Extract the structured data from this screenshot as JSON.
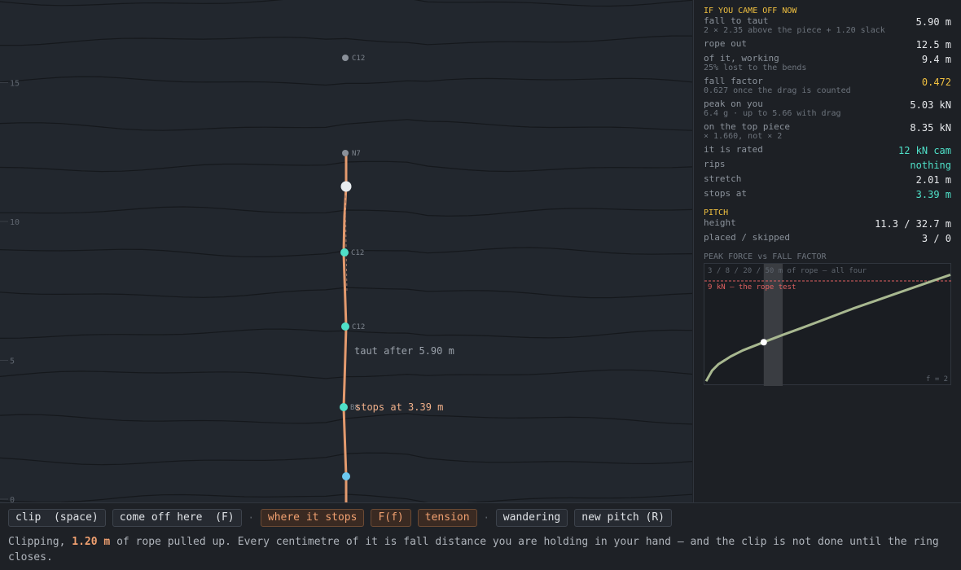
{
  "wall": {
    "axis_ticks": [
      "15",
      "10",
      "5",
      "0"
    ],
    "pieces": [
      {
        "label": "C12",
        "kind": "placed-grey"
      },
      {
        "label": "N7",
        "kind": "top"
      },
      {
        "label": "C12",
        "kind": "clipped"
      },
      {
        "label": "C12",
        "kind": "clipped"
      },
      {
        "label": "B8",
        "kind": "clipped"
      }
    ],
    "annotations": {
      "taut": "taut after 5.90 m",
      "stops": "stops at 3.39 m"
    }
  },
  "panel": {
    "section1_title": "IF YOU CAME OFF NOW",
    "stats": [
      {
        "label": "fall to taut",
        "sub": "2 × 2.35 above the piece + 1.20 slack",
        "value": "5.90 m",
        "color": "white"
      },
      {
        "label": "rope out",
        "sub": "",
        "value": "12.5 m",
        "color": "white"
      },
      {
        "label": "of it, working",
        "sub": "25% lost to the bends",
        "value": "9.4 m",
        "color": "white"
      },
      {
        "label": "fall factor",
        "sub": "0.627 once the drag is counted",
        "value": "0.472",
        "color": "yellow"
      },
      {
        "label": "peak on you",
        "sub": "6.4 g · up to 5.66 with drag",
        "value": "5.03 kN",
        "color": "white"
      },
      {
        "label": "on the top piece",
        "sub": "× 1.660, not × 2",
        "value": "8.35 kN",
        "color": "white"
      },
      {
        "label": "it is rated",
        "sub": "",
        "value": "12 kN cam",
        "color": "cyan"
      },
      {
        "label": "rips",
        "sub": "",
        "value": "nothing",
        "color": "cyan"
      },
      {
        "label": "stretch",
        "sub": "",
        "value": "2.01 m",
        "color": "white"
      },
      {
        "label": "stops at",
        "sub": "",
        "value": "3.39 m",
        "color": "cyan"
      }
    ],
    "section2_title": "PITCH",
    "pitch_stats": [
      {
        "label": "height",
        "value": "11.3 / 32.7 m"
      },
      {
        "label": "placed / skipped",
        "value": "3 / 0"
      }
    ],
    "chart_title": "PEAK FORCE vs FALL FACTOR"
  },
  "chart_data": {
    "type": "line",
    "title": "PEAK FORCE vs FALL FACTOR",
    "top_note": "3 / 8 / 20 / 50 m of rope — all four",
    "threshold_label": "9 kN — the rope test",
    "threshold_kN": 9,
    "xlabel_right": "f = 2",
    "xlim": [
      0,
      2
    ],
    "ylim": [
      2.3,
      10
    ],
    "current_marker": {
      "x": 0.472,
      "y": 5.03
    },
    "highlight_band_x": [
      0.472,
      0.627
    ],
    "series": [
      {
        "x": [
          0.0,
          0.05,
          0.1,
          0.2,
          0.3,
          0.472,
          0.627,
          0.8,
          1.0,
          1.2,
          1.4,
          1.6,
          1.8,
          2.0
        ],
        "y": [
          2.5,
          3.2,
          3.6,
          4.1,
          4.5,
          5.03,
          5.5,
          6.0,
          6.6,
          7.2,
          7.75,
          8.3,
          8.85,
          9.4
        ]
      }
    ],
    "colors": {
      "curve": "#a8b890",
      "threshold": "#e06060",
      "band": "#3a3d42",
      "marker": "#ffffff"
    }
  },
  "buttons": [
    {
      "label": "clip  (space)",
      "style": "normal",
      "name": "clip-button"
    },
    {
      "label": "come off here  (F)",
      "style": "normal",
      "name": "come-off-button"
    },
    {
      "sep": "·"
    },
    {
      "label": "where it stops",
      "style": "orange",
      "name": "where-it-stops-toggle"
    },
    {
      "label": "F(f)",
      "style": "orange",
      "name": "force-function-toggle"
    },
    {
      "label": "tension",
      "style": "orange",
      "name": "tension-toggle"
    },
    {
      "sep": "·"
    },
    {
      "label": "wandering",
      "style": "normal",
      "name": "wandering-button"
    },
    {
      "label": "new pitch (R)",
      "style": "normal",
      "name": "new-pitch-button"
    }
  ],
  "message": {
    "before": "Clipping, ",
    "highlight": "1.20 m",
    "after": " of rope pulled up. Every centimetre of it is fall distance you are holding in your hand — and the clip is not done until the ring closes."
  }
}
